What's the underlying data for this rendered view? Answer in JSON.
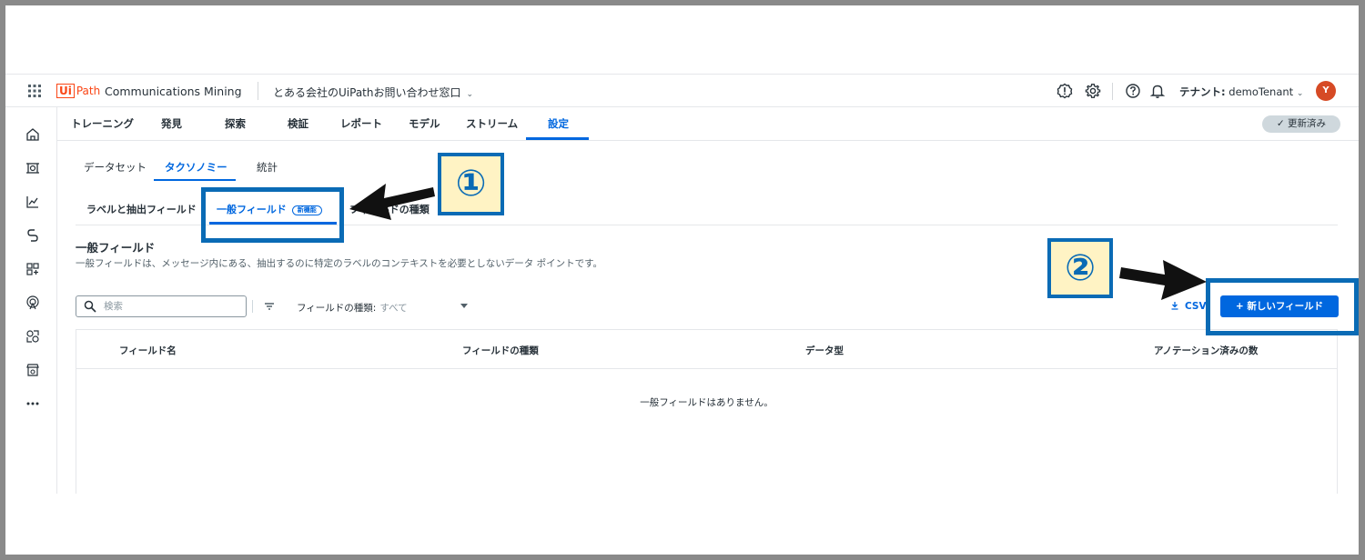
{
  "app": {
    "brand_ui": "Ui",
    "brand_path": "Path",
    "product": "Communications Mining",
    "workspace": "とある会社のUiPathお問い合わせ窓口",
    "tenant_label": "テナント:",
    "tenant_value": "demoTenant",
    "avatar_initial": "Y"
  },
  "nav": {
    "items": [
      "トレーニング",
      "発見",
      "探索",
      "検証",
      "レポート",
      "モデル",
      "ストリーム",
      "設定"
    ],
    "active": "設定",
    "status": "✓ 更新済み"
  },
  "subtabs": {
    "items": [
      "データセット",
      "タクソノミー",
      "統計"
    ],
    "active": "タクソノミー"
  },
  "tabs": {
    "labels_fields": "ラベルと抽出フィールド",
    "general_fields": "一般フィールド",
    "new_badge": "新機能",
    "field_types": "フィールドの種類"
  },
  "section": {
    "title": "一般フィールド",
    "description": "一般フィールドは、メッセージ内にある、抽出するのに特定のラベルのコンテキストを必要としないデータ ポイントです。"
  },
  "toolbar": {
    "search_placeholder": "検索",
    "filter_label": "フィールドの種類:",
    "filter_value": "すべて",
    "csv": "CSV",
    "new_field": "+ 新しいフィールド"
  },
  "table": {
    "columns": [
      "フィールド名",
      "フィールドの種類",
      "データ型",
      "アノテーション済みの数"
    ],
    "empty": "一般フィールドはありません。"
  },
  "annotations": {
    "callout1": "①",
    "callout2": "②"
  },
  "colors": {
    "accent": "#0067df",
    "brand": "#fa4616",
    "annotation": "#0a6bb5",
    "callout_bg": "#fff3c4"
  }
}
